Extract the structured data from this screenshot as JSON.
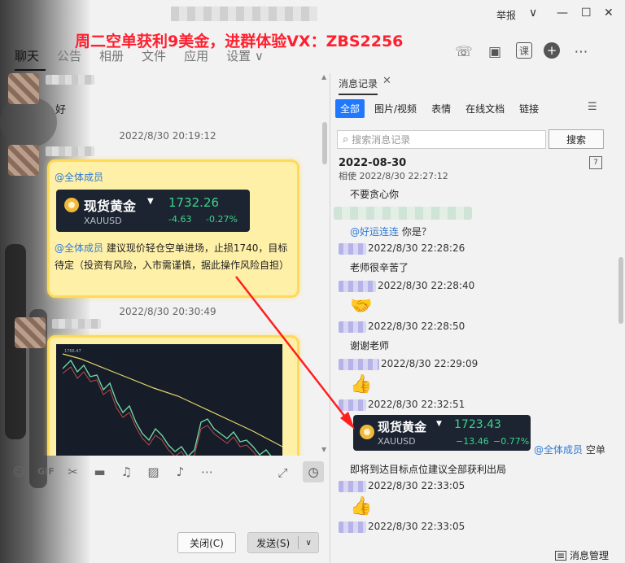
{
  "window": {
    "report": "举报",
    "watermark": "周二空单获利9美金，进群体验VX：ZBS2256"
  },
  "tabs": [
    "聊天",
    "公告",
    "相册",
    "文件",
    "应用",
    "设置 ∨"
  ],
  "head_icons": [
    "phone-icon",
    "video-icon",
    "class-icon",
    "add-icon",
    "more-icon"
  ],
  "chat": {
    "msg1_text": "好",
    "time1": "2022/8/30 20:19:12",
    "mention_all": "@全体成员",
    "gold_card_1": {
      "title": "现货黄金",
      "symbol": "XAUUSD",
      "price": "1732.26",
      "change": "-4.63",
      "change_pct": "-0.27%"
    },
    "msg2_body": "建议现价轻仓空单进场，止损1740，目标待定（投资有风险，入市需谨慎，据此操作风险自担）",
    "time2": "2022/8/30 20:30:49"
  },
  "toolbar": {
    "gif": "GIF",
    "close": "关闭(C)",
    "send": "发送(S)"
  },
  "history": {
    "tab": "消息记录",
    "filters": [
      "全部",
      "图片/视频",
      "表情",
      "在线文档",
      "链接"
    ],
    "search_placeholder": "搜索消息记录",
    "search_button": "搜索",
    "date": "2022-08-30",
    "cal_num": "7",
    "partial_top": "相使 2022/8/30 22:27:12",
    "item1": "不要贪心你",
    "mention_user": "@好运连连",
    "item2_tail": "你是？",
    "time_a": "2022/8/30 22:28:26",
    "item3": "老师很辛苦了",
    "time_b": "2022/8/30 22:28:40",
    "time_c": "2022/8/30 22:28:50",
    "item4": "谢谢老师",
    "time_d": "2022/8/30 22:29:09",
    "time_e": "2022/8/30 22:32:51",
    "gold_card_2": {
      "title": "现货黄金",
      "symbol": "XAUUSD",
      "price": "1723.43",
      "change": "−13.46",
      "change_pct": "−0.77%"
    },
    "mention_all": "@全体成员",
    "item5_tail": "空单",
    "item6": "即将到达目标点位建议全部获利出局",
    "time_f": "2022/8/30 22:33:05",
    "time_g": "2022/8/30 22:33:05",
    "manage": "消息管理"
  },
  "colors": {
    "watermark": "#ff1f2e",
    "mention": "#2f7bd6",
    "accent": "#1f78ff",
    "gold_up": "#3ad48b",
    "bubble": "#fff0a8"
  }
}
